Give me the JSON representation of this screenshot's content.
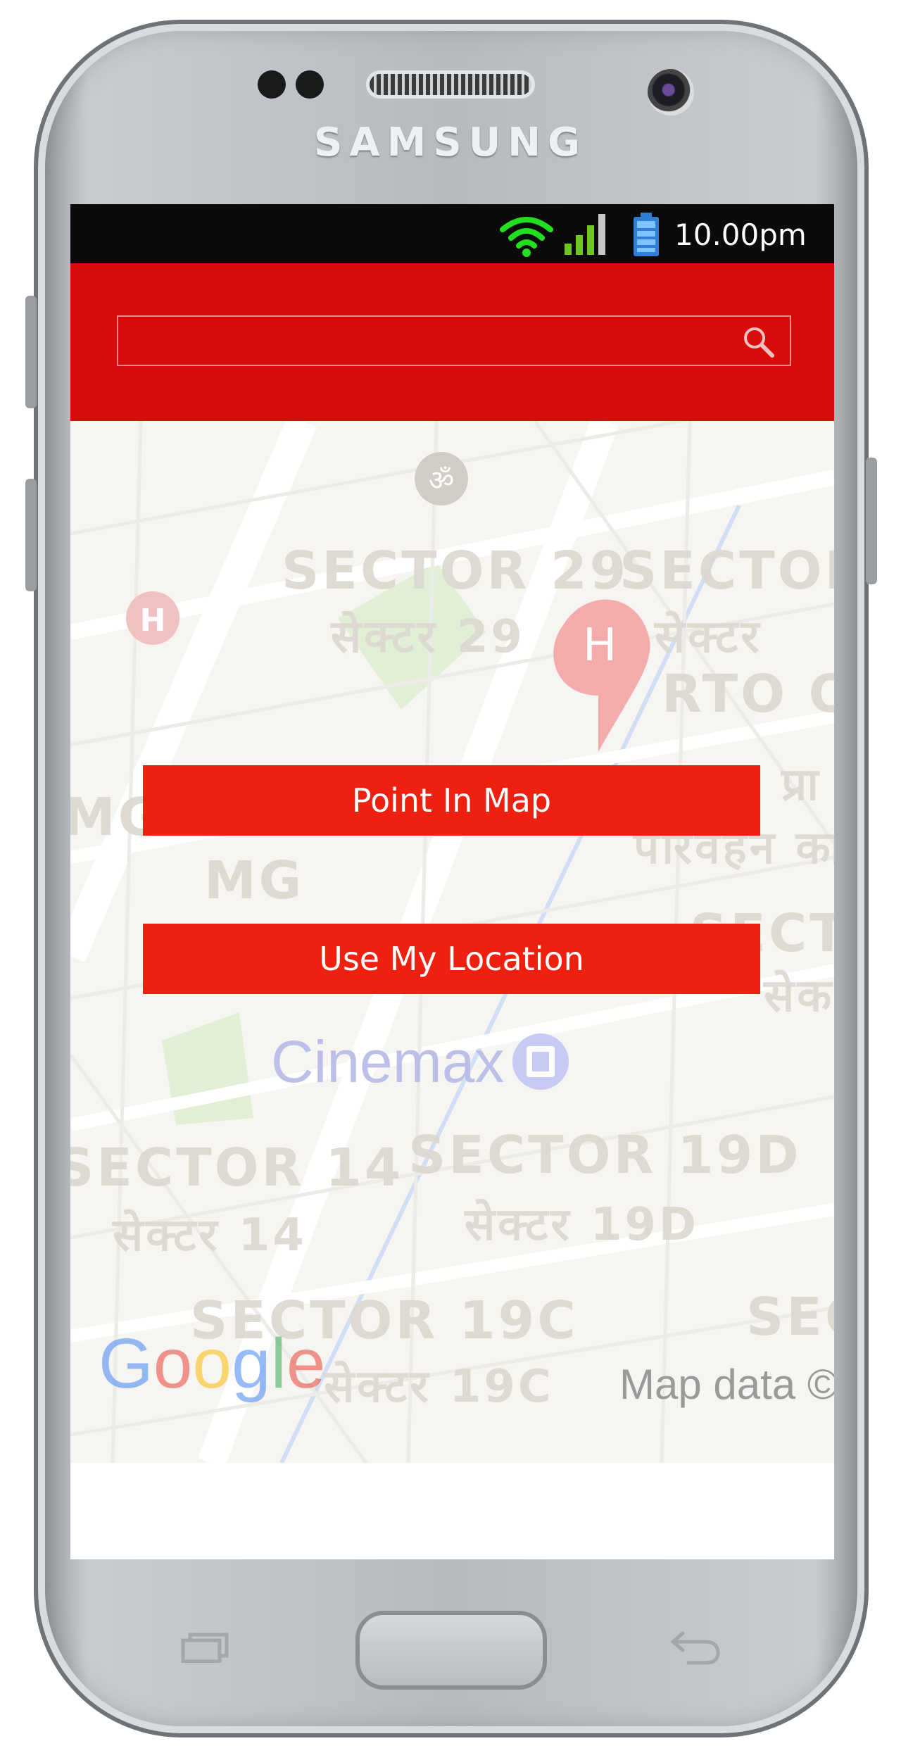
{
  "device": {
    "brand": "SAMSUNG"
  },
  "status_bar": {
    "time": "10.00pm"
  },
  "search": {
    "value": "",
    "placeholder": ""
  },
  "map": {
    "labels": {
      "sector29": "SECTOR 29",
      "sector29_hi": "सेक्टर 29",
      "sector_right": "SECTOR",
      "sector_right_hi": "सेक्टर",
      "rto": "RTO O",
      "rto_hi_1": "प्रा",
      "rto_hi_2": "परिवहन का",
      "mg_complex": "MG COMPLEX",
      "mg": "MG",
      "sect_right2": "SECT",
      "sect_right2_hi": "सेक",
      "cinema": "Cinemax",
      "sector14": "SECTOR 14",
      "sector14_hi": "सेक्टर 14",
      "sector19d": "SECTOR 19D",
      "sector19d_hi": "सेक्टर 19D",
      "sector19c": "SECTOR 19C",
      "sector19c_hi": "सेक्टर 19C",
      "sec_right3": "SEC"
    },
    "google_logo": "Google",
    "attribution": "Map data ©"
  },
  "buttons": {
    "point_in_map": "Point In Map",
    "use_my_location": "Use My Location"
  },
  "colors": {
    "header": "#d90b0b",
    "button": "#ee200f",
    "status_bar": "#0b0b0b",
    "wifi": "#22e01f",
    "signal": "#6cc91a"
  }
}
